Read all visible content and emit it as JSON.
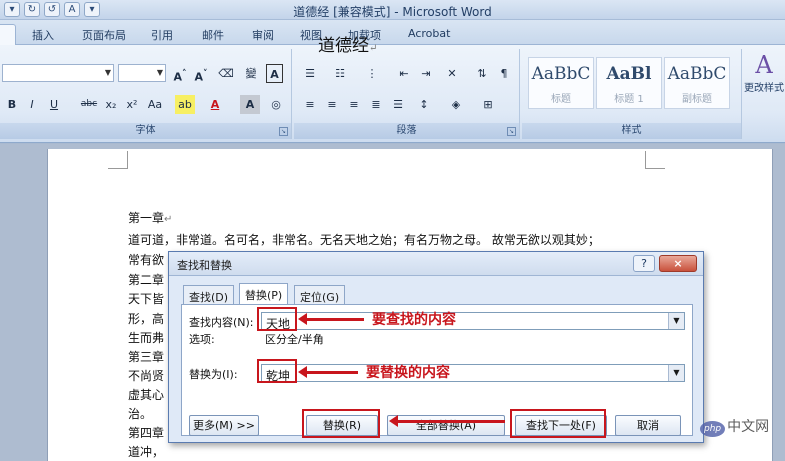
{
  "window": {
    "title": "道德经 [兼容模式] - Microsoft Word"
  },
  "ribbon": {
    "tabs": [
      "插入",
      "页面布局",
      "引用",
      "邮件",
      "审阅",
      "视图",
      "加载项",
      "Acrobat"
    ],
    "groups": {
      "font": "字体",
      "paragraph": "段落",
      "styles": "样式"
    },
    "styles": [
      {
        "sample": "AaBbC",
        "name": "标题"
      },
      {
        "sample": "AaBl",
        "name": "标题 1"
      },
      {
        "sample": "AaBbC",
        "name": "副标题"
      }
    ],
    "change_styles": "更改样式",
    "font_buttons": {
      "bold": "B",
      "italic": "I",
      "underline": "U",
      "strike": "abc",
      "sub": "x₂",
      "sup": "x²",
      "case": "Aa",
      "color": "A",
      "shade": "A"
    }
  },
  "document": {
    "title": "道德经",
    "lines": [
      "第一章",
      "道可道，非常道。名可名，非常名。无名天地之始；有名万物之母。 故常无欲以观其妙；",
      "常有欲",
      "第二章",
      "天下皆",
      "形，高",
      "生而弗",
      "第三章",
      "不尚贤",
      "虚其心",
      "治。",
      "第四章",
      "道冲，"
    ]
  },
  "dialog": {
    "title": "查找和替换",
    "help": "?",
    "close": "×",
    "tabs": [
      "查找(D)",
      "替换(P)",
      "定位(G)"
    ],
    "find_label": "查找内容(N):",
    "find_value": "天地",
    "options_label": "选项:",
    "options_value": "区分全/半角",
    "replace_label": "替换为(I):",
    "replace_value": "乾坤",
    "buttons": {
      "more": "更多(M) >>",
      "replace": "替换(R)",
      "replace_all": "全部替换(A)",
      "find_next": "查找下一处(F)",
      "cancel": "取消"
    }
  },
  "annotations": {
    "find": "要查找的内容",
    "replace": "要替换的内容"
  },
  "watermark": {
    "badge": "php",
    "text": "中文网"
  }
}
